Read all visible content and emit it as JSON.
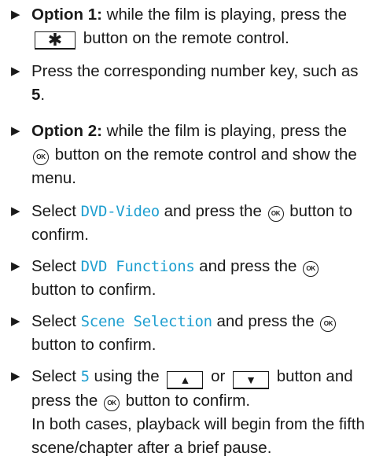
{
  "steps": [
    {
      "label": "Option 1:",
      "t1": " while the film is playing, press the ",
      "key": "✱",
      "t2": " button on the remote control."
    },
    {
      "t1": "Press the corresponding number key, such as ",
      "bold": "5",
      "t2": "."
    },
    {
      "label": "Option 2:",
      "t1": " while the film is playing, press the ",
      "ok": "OK",
      "t2": " button on the remote control and show the menu."
    },
    {
      "t1": "Select ",
      "display": "DVD-Video",
      "t2": " and press the ",
      "ok": "OK",
      "t3": " button to confirm."
    },
    {
      "t1": "Select ",
      "display": "DVD Functions",
      "t2": " and press the ",
      "ok": "OK",
      "t3": " button to confirm."
    },
    {
      "t1": "Select ",
      "display": "Scene Selection",
      "t2": " and press the ",
      "ok": "OK",
      "t3": " button to confirm."
    },
    {
      "t1": "Select ",
      "display": "5",
      "t2": " using the ",
      "key_up": "▲",
      "t3": " or ",
      "key_down": "▼",
      "t4": " button and press the ",
      "ok": "OK",
      "t5": " button to confirm.",
      "result": "In both cases, playback will begin from the fifth scene/chapter after a brief pause."
    }
  ],
  "icons": {
    "bullet": "▶",
    "ok_button": "ok-button-icon",
    "star_key": "star-key-icon"
  },
  "colors": {
    "display_text": "#1f9fd0",
    "text": "#1a1a1a"
  }
}
